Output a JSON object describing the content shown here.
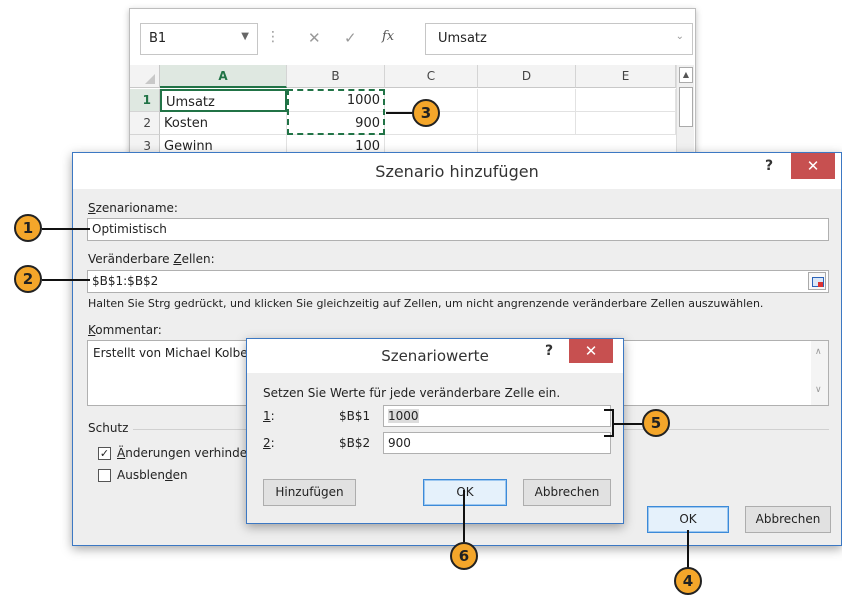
{
  "excel": {
    "name_box": "B1",
    "formula_content": "Umsatz",
    "fx_symbol": "fx",
    "columns": [
      "A",
      "B",
      "C",
      "D",
      "E"
    ],
    "rows": [
      {
        "num": "1",
        "a": "Umsatz",
        "b": "1000"
      },
      {
        "num": "2",
        "a": "Kosten",
        "b": "900"
      },
      {
        "num": "3",
        "a": "Gewinn",
        "b": "100"
      }
    ]
  },
  "dialog": {
    "title": "Szenario hinzufügen",
    "help": "?",
    "close": "✕",
    "scenario_name_label_u": "S",
    "scenario_name_label_rest": "zenarioname:",
    "scenario_name_value": "Optimistisch",
    "changing_cells_label_pre": "Veränderbare ",
    "changing_cells_label_u": "Z",
    "changing_cells_label_rest": "ellen:",
    "changing_cells_value": "$B$1:$B$2",
    "hint": "Halten Sie Strg gedrückt, und klicken Sie gleichzeitig auf Zellen, um nicht angrenzende veränderbare Zellen auszuwählen.",
    "comment_label_u": "K",
    "comment_label_rest": "ommentar:",
    "comment_value": "Erstellt von Michael Kolbe",
    "protection_label": "Schutz",
    "prevent_changes_u": "Ä",
    "prevent_changes_rest": "nderungen verhindern",
    "hide_pre": "Ausblen",
    "hide_u": "d",
    "hide_rest": "en",
    "ok": "OK",
    "cancel": "Abbrechen"
  },
  "values_dialog": {
    "title": "Szenariowerte",
    "help": "?",
    "close": "✕",
    "instruction": "Setzen Sie Werte für jede veränderbare Zelle ein.",
    "rows": [
      {
        "idx_u": "1",
        "ref": "$B$1",
        "value": "1000"
      },
      {
        "idx_u": "2",
        "ref": "$B$2",
        "value": "900"
      }
    ],
    "add": "Hinzufügen",
    "ok": "OK",
    "cancel": "Abbrechen"
  },
  "callouts": [
    "1",
    "2",
    "3",
    "4",
    "5",
    "6"
  ]
}
